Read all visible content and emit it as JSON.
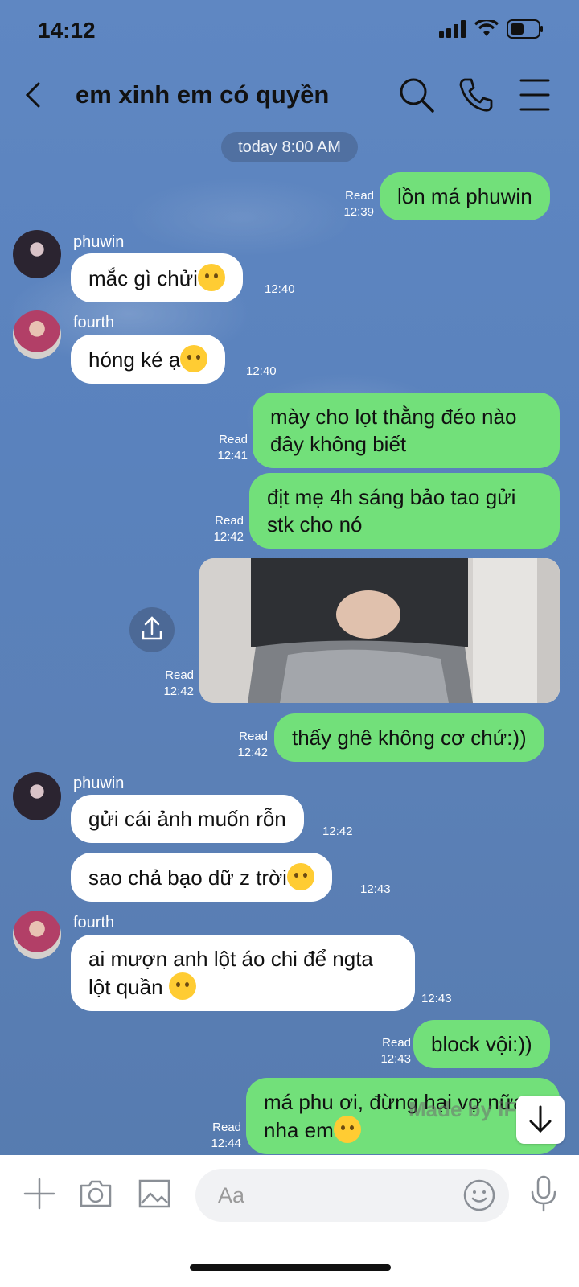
{
  "status": {
    "time": "14:12"
  },
  "header": {
    "title": "em xinh em có quyền"
  },
  "date_pill": "today 8:00 AM",
  "messages": [
    {
      "from": "me",
      "text": "lồn má phuwin",
      "read": "Read",
      "time": "12:39"
    },
    {
      "from": "phuwin",
      "name": "phuwin",
      "text": "mắc gì chửi",
      "emoji": "melting-face",
      "time": "12:40"
    },
    {
      "from": "fourth",
      "name": "fourth",
      "text": "hóng ké ạ",
      "emoji": "kissing-face",
      "time": "12:40"
    },
    {
      "from": "me",
      "line1": "mày cho lọt thằng đéo nào",
      "line2": "đây không biết",
      "read": "Read",
      "time": "12:41"
    },
    {
      "from": "me",
      "line1": "địt mẹ 4h sáng bảo tao gửi",
      "line2": "stk cho nó",
      "read": "Read",
      "time": "12:42"
    },
    {
      "from": "me",
      "type": "photo",
      "read": "Read",
      "time": "12:42"
    },
    {
      "from": "me",
      "text": "thấy ghê không cơ chứ:))",
      "read": "Read",
      "time": "12:42"
    },
    {
      "from": "phuwin",
      "name": "phuwin",
      "text": "gửi cái ảnh muốn rỗn",
      "time": "12:42"
    },
    {
      "from": "phuwin",
      "text": "sao chả bạo dữ z trời",
      "emoji": "halo-face",
      "time": "12:43"
    },
    {
      "from": "fourth",
      "name": "fourth",
      "line1": "ai mượn anh lột áo chi để ngta",
      "line2": "lột quần",
      "emoji": "smirk-face",
      "time": "12:43"
    },
    {
      "from": "me",
      "text": "block vội:))",
      "read": "Read",
      "time": "12:43"
    },
    {
      "from": "me",
      "line1": "má phu ơi, đừng hại vợ nữa",
      "line2": "nha em",
      "emoji": "pleading-face",
      "read": "Read",
      "time": "12:44"
    }
  ],
  "watermark": "Made by iFake",
  "input": {
    "placeholder": "Aa"
  },
  "colors": {
    "outgoing": "#72e07a",
    "incoming": "#ffffff",
    "background": "#5a82bd"
  }
}
